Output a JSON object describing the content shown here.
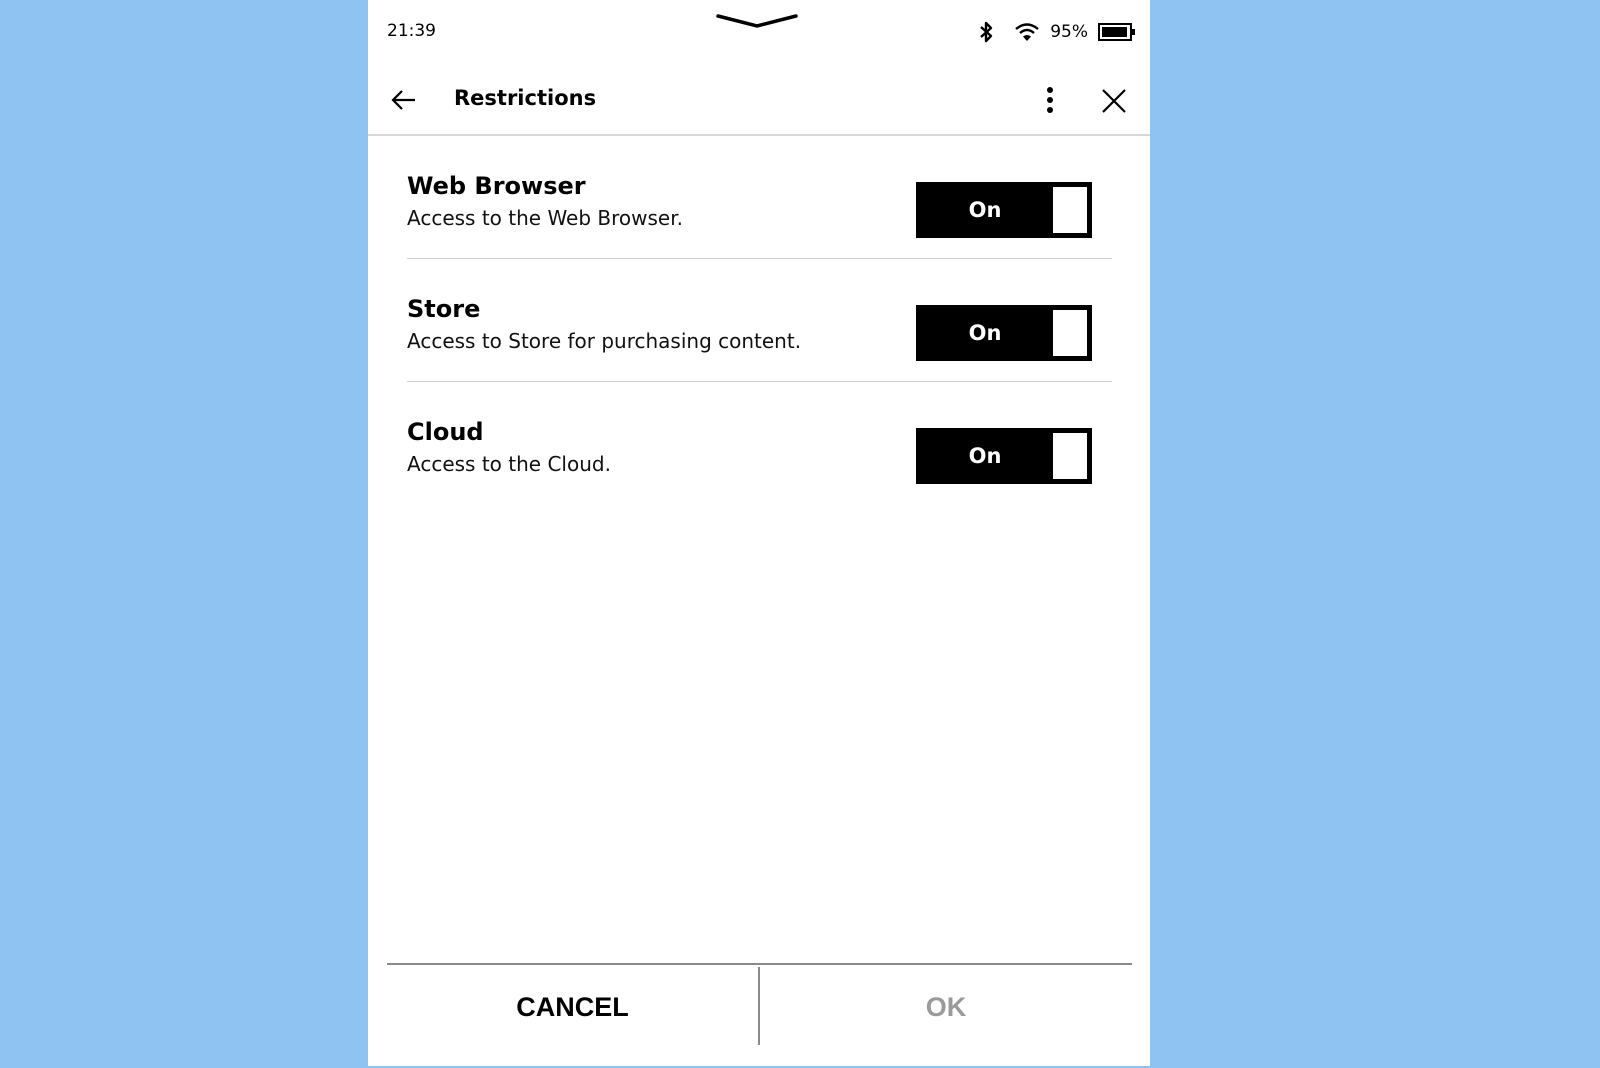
{
  "status_bar": {
    "time": "21:39",
    "battery_percent": "95%",
    "battery_level": 0.95,
    "icons": [
      "bluetooth-icon",
      "wifi-icon",
      "battery-icon"
    ]
  },
  "header": {
    "title": "Restrictions",
    "icons": [
      "back-arrow-icon",
      "more-vertical-icon",
      "close-icon"
    ]
  },
  "restrictions": [
    {
      "title": "Web Browser",
      "description": "Access to the Web Browser.",
      "toggle_label": "On",
      "enabled": true
    },
    {
      "title": "Store",
      "description": "Access to Store for purchasing content.",
      "toggle_label": "On",
      "enabled": true
    },
    {
      "title": "Cloud",
      "description": "Access to the Cloud.",
      "toggle_label": "On",
      "enabled": true
    }
  ],
  "footer": {
    "cancel_label": "CANCEL",
    "ok_label": "OK",
    "ok_disabled": true
  },
  "colors": {
    "background": "#8fc3f2",
    "surface": "#ffffff",
    "toggle_on": "#000000",
    "disabled_text": "#9a9a9a"
  }
}
